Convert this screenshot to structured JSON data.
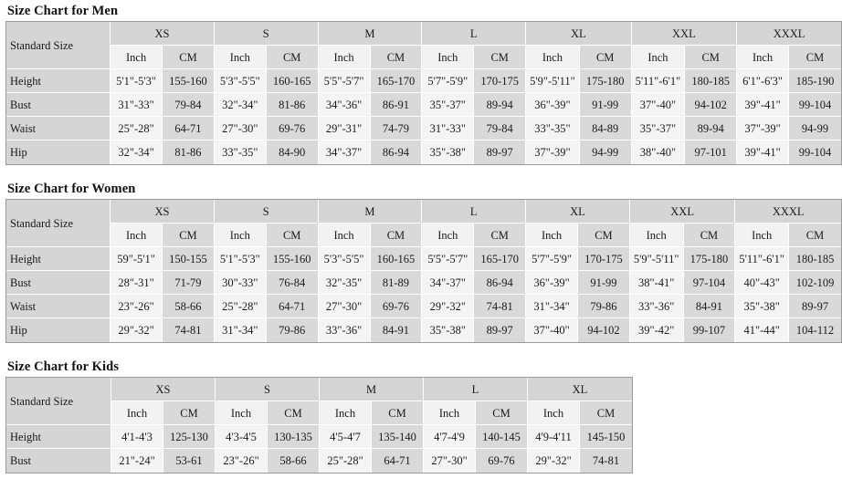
{
  "page": {
    "background_color": "#ffffff",
    "header_bg": "#d5d5d5",
    "inch_cell_bg": "#f2f2f2",
    "cm_cell_bg": "#d9d9d9",
    "border_color": "#9a9a9a"
  },
  "charts": [
    {
      "id": "men",
      "title": "Size Chart for Men",
      "corner_label": "Standard Size",
      "sizes": [
        "XS",
        "S",
        "M",
        "L",
        "XL",
        "XXL",
        "XXXL"
      ],
      "units": [
        "Inch",
        "CM"
      ],
      "rows": [
        {
          "label": "Height",
          "cells": [
            "5'1\"-5'3\"",
            "155-160",
            "5'3\"-5'5\"",
            "160-165",
            "5'5\"-5'7\"",
            "165-170",
            "5'7\"-5'9\"",
            "170-175",
            "5'9\"-5'11\"",
            "175-180",
            "5'11\"-6'1\"",
            "180-185",
            "6'1\"-6'3\"",
            "185-190"
          ]
        },
        {
          "label": "Bust",
          "cells": [
            "31\"-33\"",
            "79-84",
            "32\"-34\"",
            "81-86",
            "34\"-36\"",
            "86-91",
            "35\"-37\"",
            "89-94",
            "36\"-39\"",
            "91-99",
            "37\"-40\"",
            "94-102",
            "39\"-41\"",
            "99-104"
          ]
        },
        {
          "label": "Waist",
          "cells": [
            "25\"-28\"",
            "64-71",
            "27\"-30\"",
            "69-76",
            "29\"-31\"",
            "74-79",
            "31\"-33\"",
            "79-84",
            "33\"-35\"",
            "84-89",
            "35\"-37\"",
            "89-94",
            "37\"-39\"",
            "94-99"
          ]
        },
        {
          "label": "Hip",
          "cells": [
            "32\"-34\"",
            "81-86",
            "33\"-35\"",
            "84-90",
            "34\"-37\"",
            "86-94",
            "35\"-38\"",
            "89-97",
            "37\"-39\"",
            "94-99",
            "38\"-40\"",
            "97-101",
            "39\"-41\"",
            "99-104"
          ]
        }
      ]
    },
    {
      "id": "women",
      "title": "Size Chart for Women",
      "corner_label": "Standard Size",
      "sizes": [
        "XS",
        "S",
        "M",
        "L",
        "XL",
        "XXL",
        "XXXL"
      ],
      "units": [
        "Inch",
        "CM"
      ],
      "rows": [
        {
          "label": "Height",
          "cells": [
            "59\"-5'1\"",
            "150-155",
            "5'1\"-5'3\"",
            "155-160",
            "5'3\"-5'5\"",
            "160-165",
            "5'5\"-5'7\"",
            "165-170",
            "5'7\"-5'9\"",
            "170-175",
            "5'9\"-5'11\"",
            "175-180",
            "5'11\"-6'1\"",
            "180-185"
          ]
        },
        {
          "label": "Bust",
          "cells": [
            "28\"-31\"",
            "71-79",
            "30\"-33\"",
            "76-84",
            "32\"-35\"",
            "81-89",
            "34\"-37\"",
            "86-94",
            "36\"-39\"",
            "91-99",
            "38\"-41\"",
            "97-104",
            "40\"-43\"",
            "102-109"
          ]
        },
        {
          "label": "Waist",
          "cells": [
            "23\"-26\"",
            "58-66",
            "25\"-28\"",
            "64-71",
            "27\"-30\"",
            "69-76",
            "29\"-32\"",
            "74-81",
            "31\"-34\"",
            "79-86",
            "33\"-36\"",
            "84-91",
            "35\"-38\"",
            "89-97"
          ]
        },
        {
          "label": "Hip",
          "cells": [
            "29\"-32\"",
            "74-81",
            "31\"-34\"",
            "79-86",
            "33\"-36\"",
            "84-91",
            "35\"-38\"",
            "89-97",
            "37\"-40\"",
            "94-102",
            "39\"-42\"",
            "99-107",
            "41\"-44\"",
            "104-112"
          ]
        }
      ]
    },
    {
      "id": "kids",
      "title": "Size Chart for Kids",
      "corner_label": "Standard Size",
      "sizes": [
        "XS",
        "S",
        "M",
        "L",
        "XL"
      ],
      "units": [
        "Inch",
        "CM"
      ],
      "rows": [
        {
          "label": "Height",
          "cells": [
            "4'1-4'3",
            "125-130",
            "4'3-4'5",
            "130-135",
            "4'5-4'7",
            "135-140",
            "4'7-4'9",
            "140-145",
            "4'9-4'11",
            "145-150"
          ]
        },
        {
          "label": "Bust",
          "cells": [
            "21\"-24\"",
            "53-61",
            "23\"-26\"",
            "58-66",
            "25\"-28\"",
            "64-71",
            "27\"-30\"",
            "69-76",
            "29\"-32\"",
            "74-81"
          ]
        }
      ]
    }
  ]
}
